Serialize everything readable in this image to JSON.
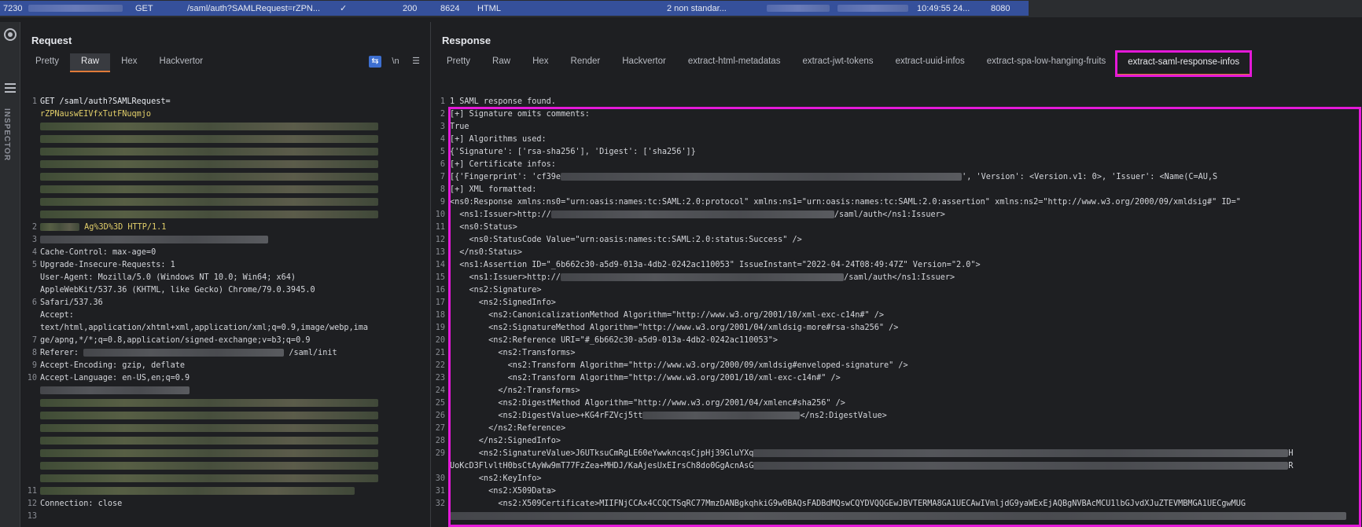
{
  "top_row": {
    "id": "7230",
    "method": "GET",
    "url": "/saml/auth?SAMLRequest=rZPN...",
    "check": "✓",
    "status": "200",
    "length": "8624",
    "mime": "HTML",
    "comment": "2 non standar...",
    "time": "10:49:55 24...",
    "port": "8080"
  },
  "sidebar": {
    "label": "INSPECTOR"
  },
  "request": {
    "title": "Request",
    "tabs": [
      "Pretty",
      "Raw",
      "Hex",
      "Hackvertor"
    ],
    "active_tab": "Raw",
    "icons": {
      "wrap": "wrap-icon",
      "newline": "\\n",
      "menu": "menu-icon"
    },
    "lines": {
      "l1a": "GET /saml/auth?SAMLRequest=",
      "l1b": "rZPNauswEIVfxTutFNuqmjo",
      "l1c": "Ag%3D%3D HTTP/1.1",
      "l3": "Cache-Control: max-age=0",
      "l4": "Upgrade-Insecure-Requests: 1",
      "l5a": "User-Agent: Mozilla/5.0 (Windows NT 10.0; Win64; x64)",
      "l5b": "AppleWebKit/537.36 (KHTML, like Gecko) Chrome/79.0.3945.0",
      "l5c": "Safari/537.36",
      "l6a": "Accept:",
      "l6b": "text/html,application/xhtml+xml,application/xml;q=0.9,image/webp,ima",
      "l6c": "ge/apng,*/*;q=0.8,application/signed-exchange;v=b3;q=0.9",
      "l7a": "Referer:",
      "l7b": "/saml/init",
      "l8": "Accept-Encoding: gzip, deflate",
      "l9": "Accept-Language: en-US,en;q=0.9",
      "l11": "Connection: close"
    },
    "numbers": [
      "1",
      "",
      "",
      "",
      "",
      "",
      "",
      "",
      "",
      "",
      "",
      "2",
      "3",
      "4",
      "5",
      "",
      "",
      "6",
      "",
      "",
      "7",
      "8",
      "9",
      "10",
      "",
      "",
      "",
      "",
      "",
      "",
      "",
      "",
      "",
      "11",
      "12",
      "13"
    ]
  },
  "response": {
    "title": "Response",
    "tabs": [
      "Pretty",
      "Raw",
      "Hex",
      "Render",
      "Hackvertor",
      "extract-html-metadatas",
      "extract-jwt-tokens",
      "extract-uuid-infos",
      "extract-spa-low-hanging-fruits",
      "extract-saml-response-infos"
    ],
    "active_tab": "extract-saml-response-infos",
    "lines": [
      {
        "n": "1",
        "t": "1 SAML response found."
      },
      {
        "n": "2",
        "t": "[+] Signature omits comments:"
      },
      {
        "n": "3",
        "t": "True"
      },
      {
        "n": "4",
        "t": "[+] Algorithms used:"
      },
      {
        "n": "5",
        "t": "{'Signature': ['rsa-sha256'], 'Digest': ['sha256']}"
      },
      {
        "n": "6",
        "t": "[+] Certificate infos:"
      },
      {
        "n": "7",
        "t": "[{'Fingerprint': 'cf39e",
        "t2": "', 'Version': <Version.v1: 0>, 'Issuer': <Name(C=AU,S"
      },
      {
        "n": "8",
        "t": "[+] XML formatted:"
      },
      {
        "n": "9",
        "t": "<ns0:Response xmlns:ns0=\"urn:oasis:names:tc:SAML:2.0:protocol\" xmlns:ns1=\"urn:oasis:names:tc:SAML:2.0:assertion\" xmlns:ns2=\"http://www.w3.org/2000/09/xmldsig#\" ID=\""
      },
      {
        "n": "10",
        "t": "  <ns1:Issuer>http://",
        "t2": "/saml/auth</ns1:Issuer>"
      },
      {
        "n": "11",
        "t": "  <ns0:Status>"
      },
      {
        "n": "12",
        "t": "    <ns0:StatusCode Value=\"urn:oasis:names:tc:SAML:2.0:status:Success\" />"
      },
      {
        "n": "13",
        "t": "  </ns0:Status>"
      },
      {
        "n": "14",
        "t": "  <ns1:Assertion ID=\"_6b662c30-a5d9-013a-4db2-0242ac110053\" IssueInstant=\"2022-04-24T08:49:47Z\" Version=\"2.0\">"
      },
      {
        "n": "15",
        "t": "    <ns1:Issuer>http://",
        "t2": "/saml/auth</ns1:Issuer>"
      },
      {
        "n": "16",
        "t": "    <ns2:Signature>"
      },
      {
        "n": "17",
        "t": "      <ns2:SignedInfo>"
      },
      {
        "n": "18",
        "t": "        <ns2:CanonicalizationMethod Algorithm=\"http://www.w3.org/2001/10/xml-exc-c14n#\" />"
      },
      {
        "n": "19",
        "t": "        <ns2:SignatureMethod Algorithm=\"http://www.w3.org/2001/04/xmldsig-more#rsa-sha256\" />"
      },
      {
        "n": "20",
        "t": "        <ns2:Reference URI=\"#_6b662c30-a5d9-013a-4db2-0242ac110053\">"
      },
      {
        "n": "21",
        "t": "          <ns2:Transforms>"
      },
      {
        "n": "22",
        "t": "            <ns2:Transform Algorithm=\"http://www.w3.org/2000/09/xmldsig#enveloped-signature\" />"
      },
      {
        "n": "23",
        "t": "            <ns2:Transform Algorithm=\"http://www.w3.org/2001/10/xml-exc-c14n#\" />"
      },
      {
        "n": "24",
        "t": "          </ns2:Transforms>"
      },
      {
        "n": "25",
        "t": "          <ns2:DigestMethod Algorithm=\"http://www.w3.org/2001/04/xmlenc#sha256\" />"
      },
      {
        "n": "26",
        "t": "          <ns2:DigestValue>+KG4rFZVcj5tt",
        "t2": "</ns2:DigestValue>"
      },
      {
        "n": "27",
        "t": "        </ns2:Reference>"
      },
      {
        "n": "28",
        "t": "      </ns2:SignedInfo>"
      },
      {
        "n": "29",
        "t": "      <ns2:SignatureValue>J6UTksuCmRgLE60eYwwkncqsCjpHj39GluYXq",
        "t2": "H"
      },
      {
        "n": "",
        "t": "UoKcD3FlvltH0bsCtAyWw9mT77FzZea+MHDJ/KaAjesUxEIrsCh8do0GgAcnAsG",
        "t2": "R"
      },
      {
        "n": "30",
        "t": "      <ns2:KeyInfo>"
      },
      {
        "n": "31",
        "t": "        <ns2:X509Data>"
      },
      {
        "n": "32",
        "t": "          <ns2:X509Certificate>MIIFNjCCAx4CCQCTSqRC77MmzDANBgkqhkiG9w0BAQsFADBdMQswCQYDVQQGEwJBVTERMA8GA1UECAwIVmljdG9yaWExEjAQBgNVBAcMCU1lbGJvdXJuZTEVMBMGA1UECgwMUG"
      }
    ]
  }
}
